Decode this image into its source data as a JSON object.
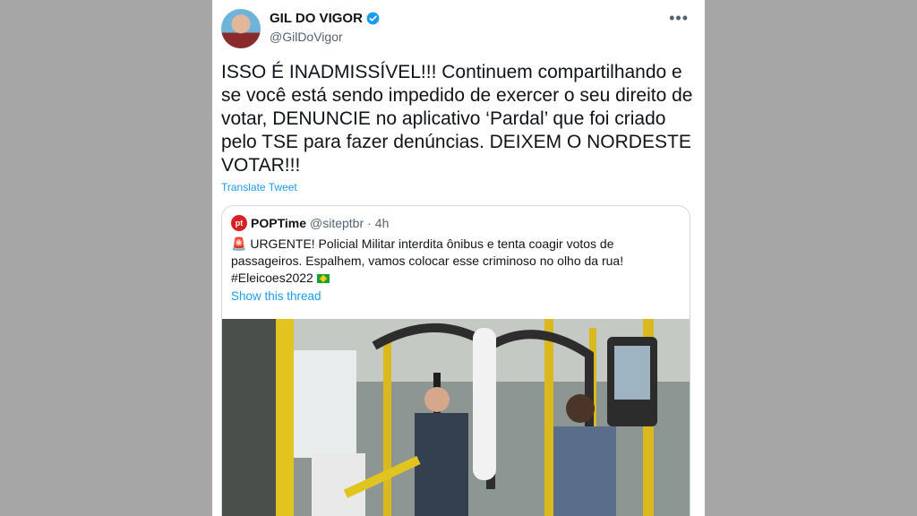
{
  "tweet": {
    "author_name": "GIL DO VIGOR",
    "author_handle": "@GilDoVigor",
    "more_icon": "more-icon",
    "text": "ISSO É INADMISSÍVEL!!! Continuem compartilhando e se você está sendo impedido de exercer o seu direito de votar, DENUNCIE no aplicativo ‘Pardal’ que foi criado pelo TSE para fazer denúncias. DEIXEM O NORDESTE VOTAR!!!",
    "translate_label": "Translate Tweet"
  },
  "quote": {
    "logo_text": "pt",
    "author_name": "POPTime",
    "author_handle": "@siteptbr",
    "separator": "·",
    "time": "4h",
    "text_part1": "URGENTE! Policial Militar interdita ônibus e tenta coagir votos de passageiros. Espalhem, vamos colocar esse criminoso no olho da rua!",
    "hashtag": "#Eleicoes2022",
    "show_thread_label": "Show this thread"
  },
  "colors": {
    "background": "#a6a6a6",
    "link": "#1d9bf0",
    "verified": "#1d9bf0",
    "text": "#0f1419",
    "secondary": "#536471"
  }
}
